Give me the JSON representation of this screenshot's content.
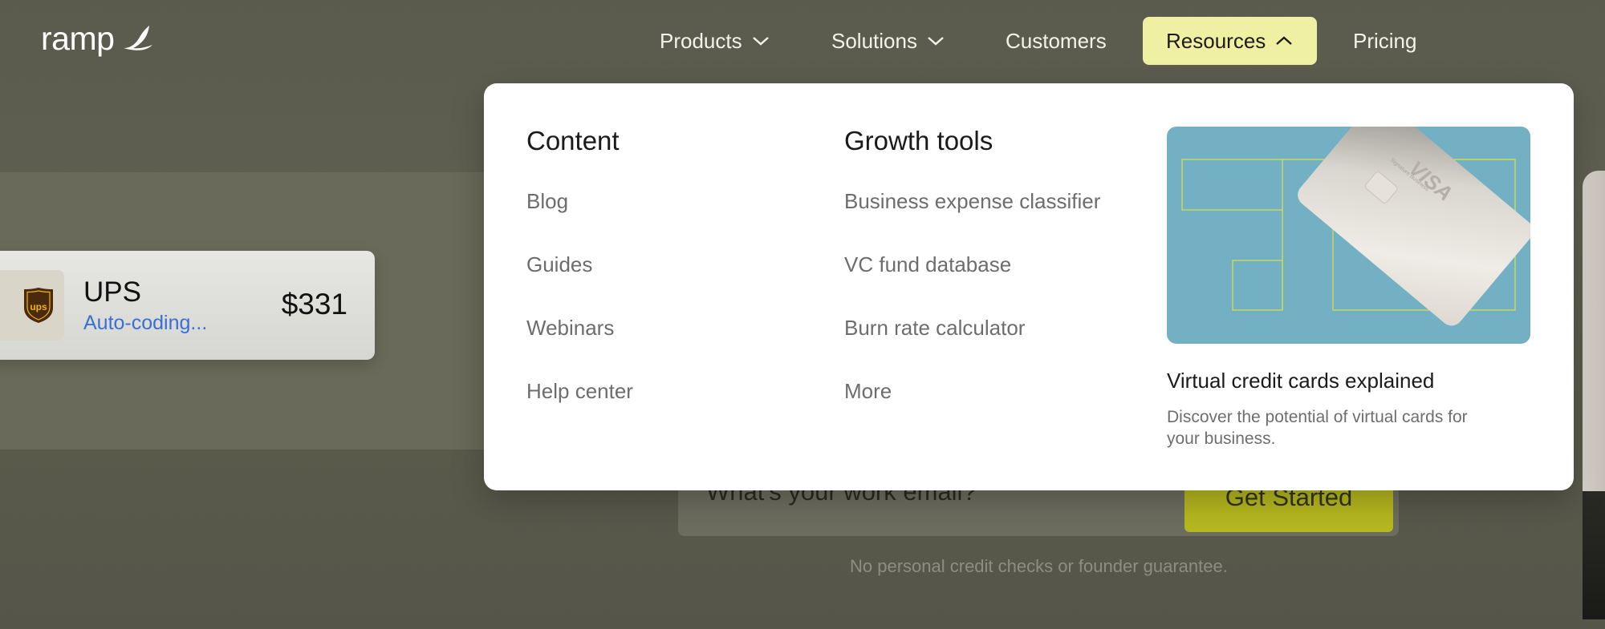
{
  "brand": {
    "name": "ramp",
    "logo_icon": "ramp-wing-icon"
  },
  "nav": {
    "products": "Products",
    "solutions": "Solutions",
    "customers": "Customers",
    "resources": "Resources",
    "pricing": "Pricing"
  },
  "colors": {
    "resources_active_bg": "#f0f0a4",
    "cta_bg": "#b6b81f",
    "status_link": "#3a6fd6"
  },
  "dropdown": {
    "content": {
      "heading": "Content",
      "links": [
        "Blog",
        "Guides",
        "Webinars",
        "Help center"
      ]
    },
    "growth": {
      "heading": "Growth tools",
      "links": [
        "Business expense classifier",
        "VC fund database",
        "Burn rate calculator",
        "More"
      ]
    },
    "feature": {
      "card_brand": "VISA",
      "card_subtext": "Signature Business",
      "title": "Virtual credit cards explained",
      "description": "Discover the potential of virtual cards for your business."
    }
  },
  "transaction": {
    "merchant": "UPS",
    "status": "Auto-coding...",
    "amount": "$331",
    "merchant_logo": "ups-shield-icon"
  },
  "signup": {
    "placeholder": "What's your work email?",
    "button": "Get Started",
    "fine_print": "No personal credit checks or founder guarantee."
  }
}
